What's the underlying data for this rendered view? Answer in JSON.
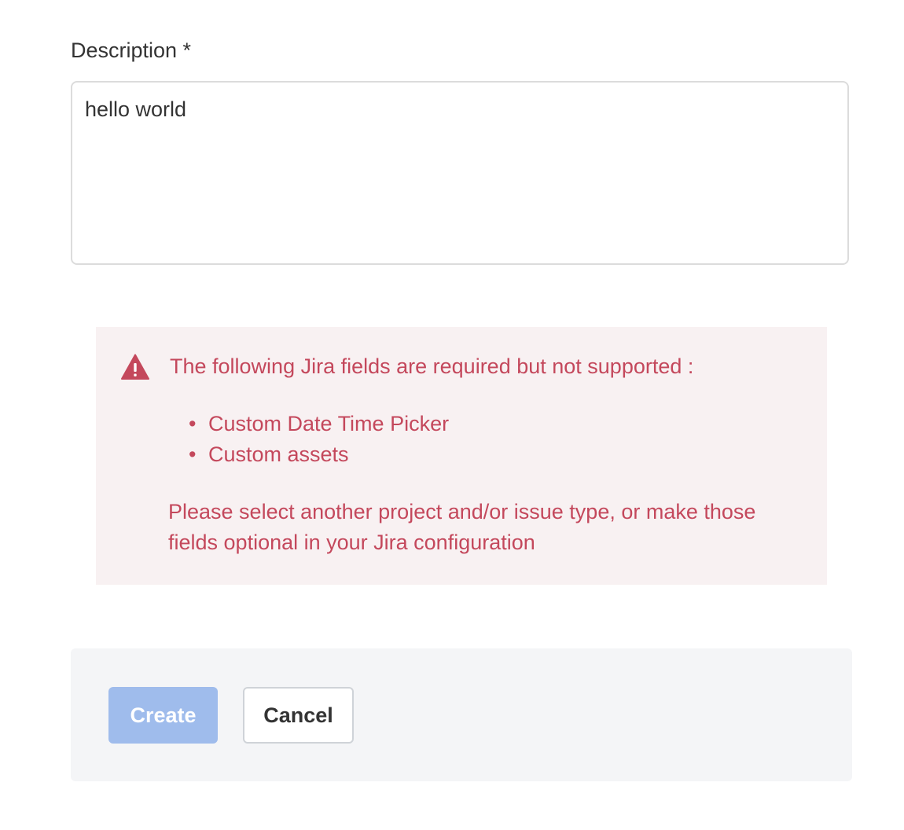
{
  "description": {
    "label": "Description *",
    "value": "hello world"
  },
  "alert": {
    "icon": "warning-triangle-icon",
    "title": "The following Jira fields are required but not supported :",
    "fields": [
      "Custom Date Time Picker",
      "Custom assets"
    ],
    "message": "Please select another project and/or issue type, or make those fields optional in your Jira configuration",
    "color": "#c4485c",
    "background": "#f8f1f2"
  },
  "actions": {
    "create_label": "Create",
    "cancel_label": "Cancel",
    "create_color": "#9fbcec"
  }
}
